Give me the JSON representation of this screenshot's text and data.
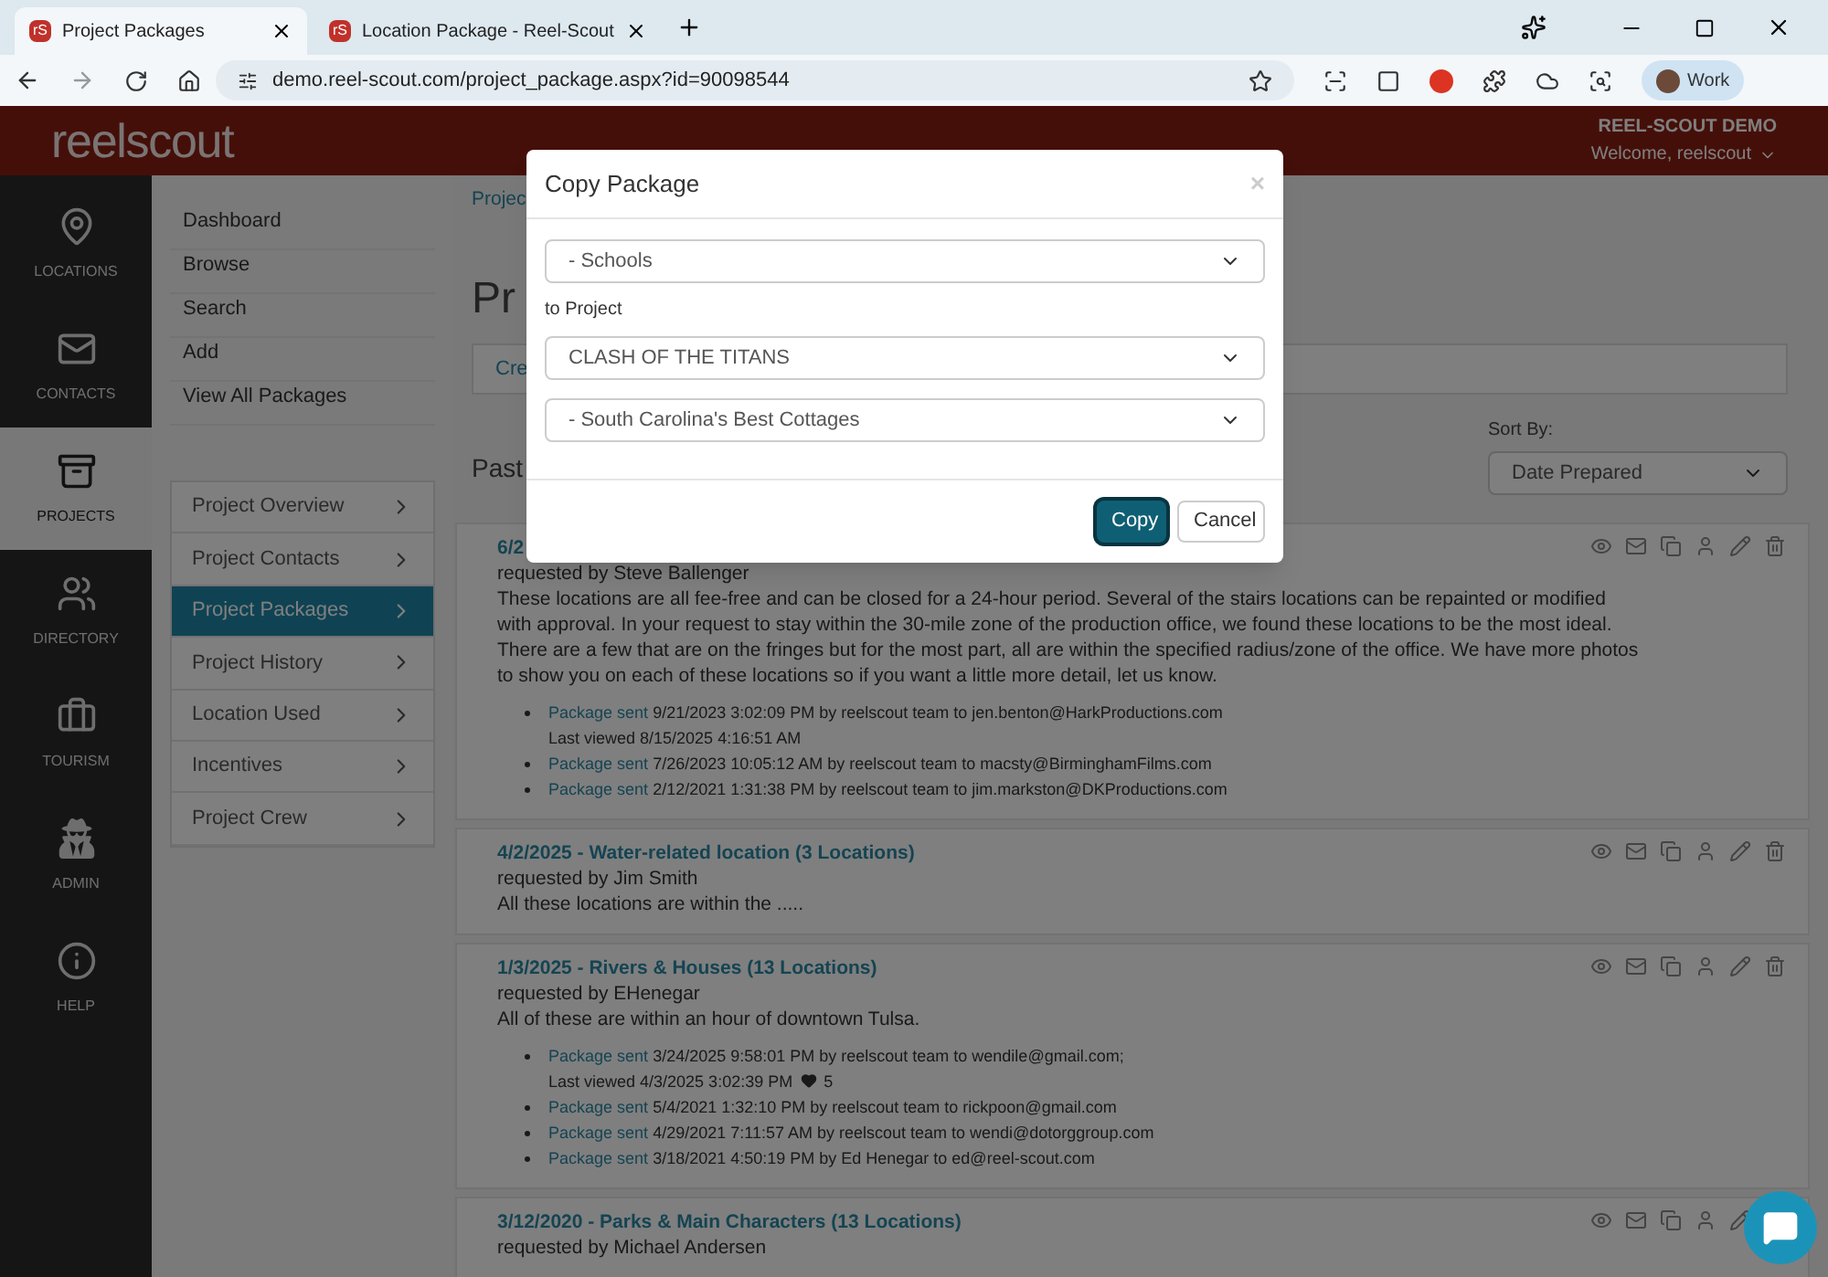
{
  "browser": {
    "tabs": [
      {
        "favicon": "rS",
        "title": "Project Packages",
        "selected": true
      },
      {
        "favicon": "rS",
        "title": "Location Package - Reel-Scout",
        "selected": false
      }
    ],
    "url": "demo.reel-scout.com/project_package.aspx?id=90098544",
    "profile": "Work"
  },
  "header": {
    "logo": "reelscout",
    "account": "REEL-SCOUT DEMO",
    "welcome": "Welcome, reelscout"
  },
  "rail": [
    {
      "label": "LOCATIONS",
      "selected": false
    },
    {
      "label": "CONTACTS",
      "selected": false
    },
    {
      "label": "PROJECTS",
      "selected": true
    },
    {
      "label": "DIRECTORY",
      "selected": false
    },
    {
      "label": "TOURISM",
      "selected": false
    },
    {
      "label": "ADMIN",
      "selected": false
    },
    {
      "label": "HELP",
      "selected": false
    }
  ],
  "nav_links": [
    "Dashboard",
    "Browse",
    "Search",
    "Add",
    "View All Packages"
  ],
  "project_menu": [
    {
      "label": "Project Overview",
      "selected": false
    },
    {
      "label": "Project Contacts",
      "selected": false
    },
    {
      "label": "Project Packages",
      "selected": true
    },
    {
      "label": "Project History",
      "selected": false
    },
    {
      "label": "Location Used",
      "selected": false
    },
    {
      "label": "Incentives",
      "selected": false
    },
    {
      "label": "Project Crew",
      "selected": false
    }
  ],
  "main": {
    "breadcrumb": "Projec",
    "heading": "Pr",
    "create_link": "Cre",
    "past_heading": "Past",
    "sort_label": "Sort By:",
    "sort_value": "Date Prepared"
  },
  "packages": [
    {
      "title": "6/2",
      "requested_by": "requested by Steve Ballenger",
      "description": "These locations are all fee-free and can be closed for a 24-hour period. Several of the stairs locations can be repainted or modified with approval. In your request to stay within the 30-mile zone of the production office, we found these locations to be the most ideal. There are a few that are on the fringes but for the most part, all are within the specified radius/zone of the office. We have more photos to show you on each of these locations so if you want a little more detail, let us know.",
      "history": [
        {
          "link": "Package sent",
          "text": "9/21/2023 3:02:09 PM by reelscout team to jen.benton@HarkProductions.com",
          "note": "Last viewed 8/15/2025 4:16:51 AM"
        },
        {
          "link": "Package sent",
          "text": "7/26/2023 10:05:12 AM by reelscout team to macsty@BirminghamFilms.com"
        },
        {
          "link": "Package sent",
          "text": "2/12/2021 1:31:38 PM by reelscout team to jim.markston@DKProductions.com"
        }
      ]
    },
    {
      "title": "4/2/2025 - Water-related location (3 Locations)",
      "requested_by": "requested by Jim Smith",
      "description": "All these locations are within the ....."
    },
    {
      "title": "1/3/2025 - Rivers & Houses (13 Locations)",
      "requested_by": "requested by EHenegar",
      "description": "All of these are within an hour of downtown Tulsa.",
      "history": [
        {
          "link": "Package sent",
          "text": "3/24/2025 9:58:01 PM by reelscout team to wendile@gmail.com;",
          "note": "Last viewed 4/3/2025 3:02:39 PM",
          "likes": "5"
        },
        {
          "link": "Package sent",
          "text": "5/4/2021 1:32:10 PM by reelscout team to rickpoon@gmail.com"
        },
        {
          "link": "Package sent",
          "text": "4/29/2021 7:11:57 AM by reelscout team to wendi@dotorggroup.com"
        },
        {
          "link": "Package sent",
          "text": "3/18/2021 4:50:19 PM by Ed Henegar to ed@reel-scout.com"
        }
      ]
    },
    {
      "title": "3/12/2020 - Parks & Main Characters (13 Locations)",
      "requested_by": "requested by Michael Andersen"
    }
  ],
  "modal": {
    "title": "Copy Package",
    "close": "×",
    "package_select": "- Schools",
    "to_label": "to Project",
    "project_select": "CLASH OF THE TITANS",
    "target_select": "- South Carolina's Best Cottages",
    "buttons": [
      {
        "label": "Copy",
        "kind": "primary"
      },
      {
        "label": "Cancel",
        "kind": "default"
      }
    ]
  }
}
